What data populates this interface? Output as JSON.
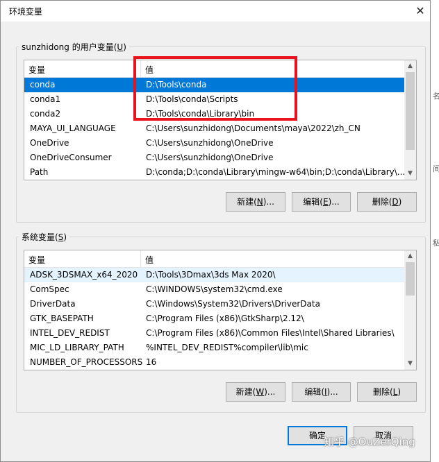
{
  "window": {
    "title": "环境变量",
    "close_glyph": "✕"
  },
  "user_vars": {
    "group_label": "sunzhidong 的用户变量",
    "group_accel": "U",
    "col_variable": "变量",
    "col_value": "值",
    "rows": [
      {
        "name": "conda",
        "value": "D:\\Tools\\conda",
        "selected": true
      },
      {
        "name": "conda1",
        "value": "D:\\Tools\\conda\\Scripts"
      },
      {
        "name": "conda2",
        "value": "D:\\Tools\\conda\\Library\\bin"
      },
      {
        "name": "MAYA_UI_LANGUAGE",
        "value": "C:\\Users\\sunzhidong\\Documents\\maya\\2022\\zh_CN"
      },
      {
        "name": "OneDrive",
        "value": "C:\\Users\\sunzhidong\\OneDrive"
      },
      {
        "name": "OneDriveConsumer",
        "value": "C:\\Users\\sunzhidong\\OneDrive"
      },
      {
        "name": "Path",
        "value": "D:\\conda;D:\\conda\\Library\\mingw-w64\\bin;D:\\conda\\Library\\..."
      }
    ],
    "buttons": {
      "new": {
        "label": "新建(",
        "accel": "N",
        "tail": ")..."
      },
      "edit": {
        "label": "编辑(",
        "accel": "E",
        "tail": ")..."
      },
      "delete": {
        "label": "删除(",
        "accel": "D",
        "tail": ")"
      }
    }
  },
  "system_vars": {
    "group_label": "系统变量",
    "group_accel": "S",
    "col_variable": "变量",
    "col_value": "值",
    "rows": [
      {
        "name": "ADSK_3DSMAX_x64_2020",
        "value": "D:\\Tools\\3Dmax\\3ds Max 2020\\"
      },
      {
        "name": "ComSpec",
        "value": "C:\\WINDOWS\\system32\\cmd.exe"
      },
      {
        "name": "DriverData",
        "value": "C:\\Windows\\System32\\Drivers\\DriverData"
      },
      {
        "name": "GTK_BASEPATH",
        "value": "C:\\Program Files (x86)\\GtkSharp\\2.12\\"
      },
      {
        "name": "INTEL_DEV_REDIST",
        "value": "C:\\Program Files (x86)\\Common Files\\Intel\\Shared Libraries\\"
      },
      {
        "name": "MIC_LD_LIBRARY_PATH",
        "value": "%INTEL_DEV_REDIST%compiler\\lib\\mic"
      },
      {
        "name": "NUMBER_OF_PROCESSORS",
        "value": "16"
      }
    ],
    "buttons": {
      "new": {
        "label": "新建(",
        "accel": "W",
        "tail": ")..."
      },
      "edit": {
        "label": "编辑(",
        "accel": "I",
        "tail": ")..."
      },
      "delete": {
        "label": "删除(",
        "accel": "L",
        "tail": ")"
      }
    }
  },
  "footer": {
    "ok": "确定",
    "cancel": "取消"
  },
  "watermark": "知乎 @OuZerQing",
  "colors": {
    "selection": "#0078d7",
    "highlight_box": "#e8131b",
    "default_button_border": "#0078d7"
  }
}
